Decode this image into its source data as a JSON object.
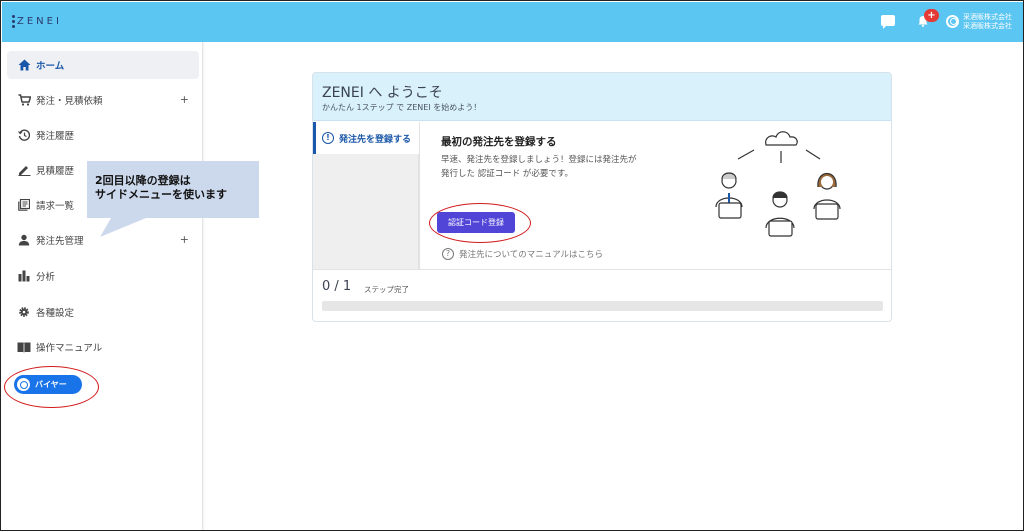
{
  "header": {
    "logo_text": "ZENEI",
    "notification_count": "+",
    "company_line1": "采酒販株式会社",
    "company_line2": "采酒販株式会社",
    "icons": [
      "chat-icon",
      "bell-icon",
      "user-account-icon"
    ],
    "bar_color": "#5cc6f2"
  },
  "sidebar": {
    "items": [
      {
        "label": "ホーム",
        "icon": "home-icon",
        "active": true
      },
      {
        "label": "発注・見積依頼",
        "icon": "cart-icon",
        "expand": "+"
      },
      {
        "label": "発注履歴",
        "icon": "history-icon"
      },
      {
        "label": "見積履歴",
        "icon": "pencil-icon"
      },
      {
        "label": "請求一覧",
        "icon": "list-icon"
      },
      {
        "label": "発注先管理",
        "icon": "person-icon",
        "expand": "+"
      },
      {
        "label": "分析",
        "icon": "bar-chart-icon"
      },
      {
        "label": "各種設定",
        "icon": "gear-icon"
      },
      {
        "label": "操作マニュアル",
        "icon": "book-icon"
      }
    ],
    "role_button": "バイヤー"
  },
  "annotation": {
    "callout_line1": "2回目以降の登録は",
    "callout_line2": "サイドメニューを使います",
    "ring_color": "#d21a1a"
  },
  "welcome": {
    "title": "ZENEI へ ようこそ",
    "subtitle": "かんたん 1ステップ で ZENEI を始めよう！",
    "step_tab": "発注先を登録する",
    "step_heading": "最初の発注先を登録する",
    "step_desc_line1": "早速、発注先を登録しましょう！登録には発注先が",
    "step_desc_line2": "発行した 認証コード が必要です。",
    "cta_label": "認証コード登録",
    "manual_link": "発注先についてのマニュアルはこちら",
    "progress_count": "0 / 1",
    "progress_label": "ステップ完了",
    "progress_fraction": 0,
    "accent_color": "#5145d8"
  }
}
